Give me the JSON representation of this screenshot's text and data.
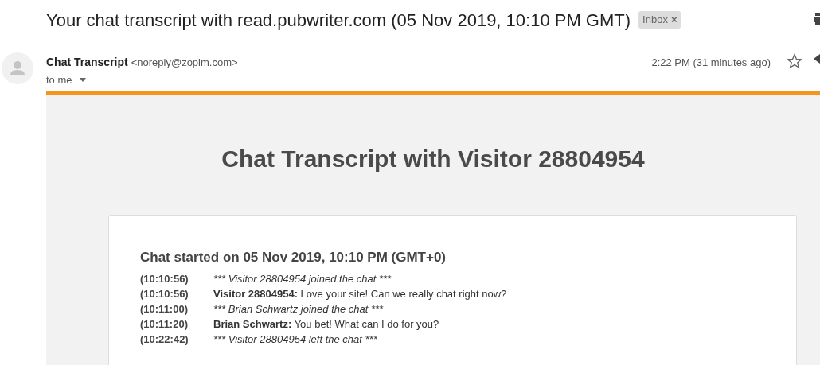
{
  "subject": "Your chat transcript with read.pubwriter.com (05 Nov 2019, 10:10 PM GMT)",
  "label": {
    "text": "Inbox",
    "close": "×"
  },
  "sender": {
    "name": "Chat Transcript",
    "email": "<noreply@zopim.com>",
    "recipient": "to me",
    "time": "2:22 PM (31 minutes ago)",
    "starred": false
  },
  "body": {
    "heading": "Chat Transcript with Visitor 28804954",
    "started": "Chat started on 05 Nov 2019, 10:10 PM (GMT+0)",
    "lines": [
      {
        "time": "(10:10:56)",
        "kind": "event",
        "text": "*** Visitor 28804954 joined the chat ***"
      },
      {
        "time": "(10:10:56)",
        "kind": "message",
        "text": "**Visitor 28804954:** Love your site! Can we really chat right now?"
      },
      {
        "time": "(10:11:00)",
        "kind": "event",
        "text": "*** Brian Schwartz joined the chat ***"
      },
      {
        "time": "(10:11:20)",
        "kind": "message",
        "text": "**Brian Schwartz:** You bet! What can I do for you?"
      },
      {
        "time": "(10:22:42)",
        "kind": "event",
        "text": "*** Visitor 28804954 left the chat ***"
      }
    ]
  }
}
